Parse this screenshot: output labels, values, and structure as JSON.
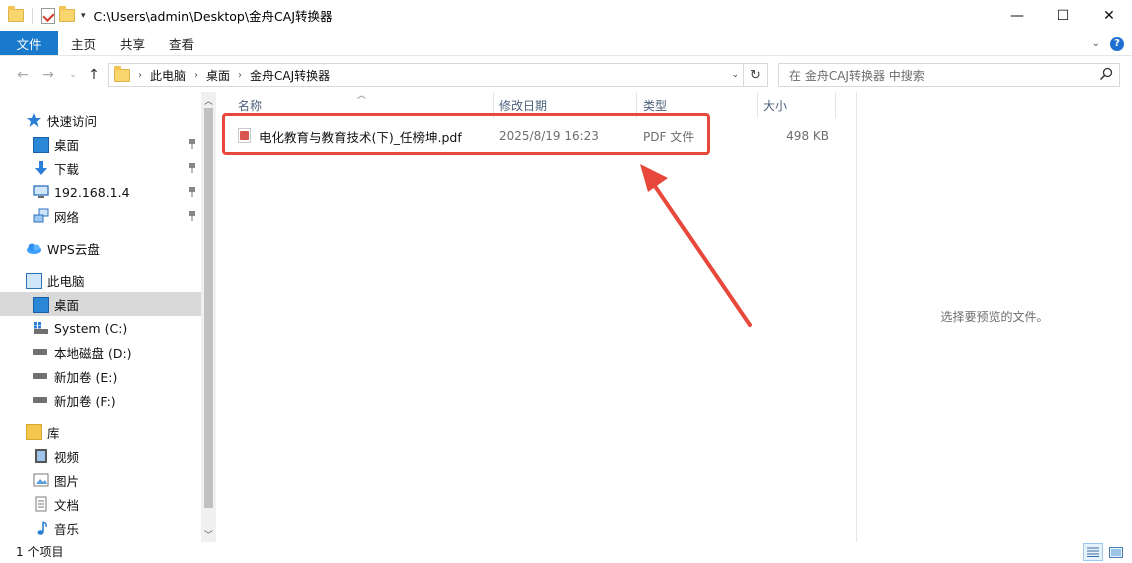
{
  "window": {
    "title": "C:\\Users\\admin\\Desktop\\金舟CAJ转换器",
    "controls": {
      "minimize": "—",
      "maximize": "☐",
      "close": "✕"
    }
  },
  "ribbon": {
    "tabs": [
      {
        "label": "文件"
      },
      {
        "label": "主页"
      },
      {
        "label": "共享"
      },
      {
        "label": "查看"
      }
    ],
    "help": "?"
  },
  "address": {
    "breadcrumb": [
      "此电脑",
      "桌面",
      "金舟CAJ转换器"
    ],
    "search_placeholder": "在 金舟CAJ转换器 中搜索"
  },
  "nav": {
    "items": [
      {
        "label": "快速访问",
        "icon": "star-icon"
      },
      {
        "label": "桌面",
        "icon": "desktop-icon",
        "pinned": true
      },
      {
        "label": "下载",
        "icon": "download-icon",
        "pinned": true
      },
      {
        "label": "192.168.1.4",
        "icon": "network-drive-icon",
        "pinned": true
      },
      {
        "label": "网络",
        "icon": "network-icon",
        "pinned": true
      },
      {
        "label": "WPS云盘",
        "icon": "cloud-icon"
      },
      {
        "label": "此电脑",
        "icon": "computer-icon"
      },
      {
        "label": "桌面",
        "icon": "desktop-icon",
        "selected": true
      },
      {
        "label": "System (C:)",
        "icon": "system-drive-icon"
      },
      {
        "label": "本地磁盘 (D:)",
        "icon": "drive-icon"
      },
      {
        "label": "新加卷 (E:)",
        "icon": "drive-icon"
      },
      {
        "label": "新加卷 (F:)",
        "icon": "drive-icon"
      },
      {
        "label": "库",
        "icon": "library-icon"
      },
      {
        "label": "视频",
        "icon": "video-icon"
      },
      {
        "label": "图片",
        "icon": "picture-icon"
      },
      {
        "label": "文档",
        "icon": "document-icon"
      },
      {
        "label": "音乐",
        "icon": "music-icon"
      }
    ]
  },
  "filelist": {
    "columns": {
      "name": "名称",
      "date": "修改日期",
      "type": "类型",
      "size": "大小"
    },
    "files": [
      {
        "name": "电化教育与教育技术(下)_任榜坤.pdf",
        "date": "2025/8/19 16:23",
        "type": "PDF 文件",
        "size": "498 KB",
        "icon": "pdf-icon"
      }
    ]
  },
  "preview": {
    "message": "选择要预览的文件。"
  },
  "status": {
    "item_count": "1 个项目"
  },
  "colors": {
    "file_tab": "#1979ca",
    "highlight": "#e8473b",
    "selected_nav": "#d9d9d9"
  }
}
